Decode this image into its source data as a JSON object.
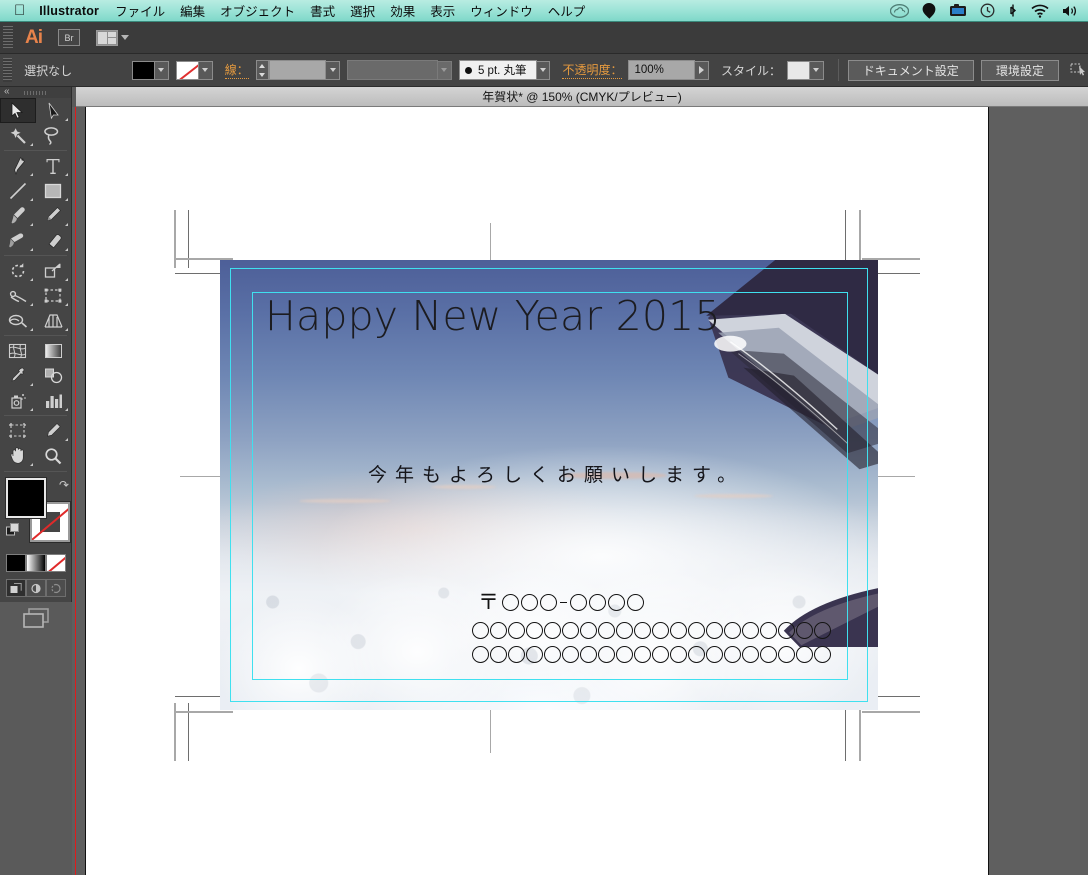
{
  "menubar": {
    "apple_icon": "apple-icon",
    "app_title": "Illustrator",
    "items": [
      "ファイル",
      "編集",
      "オブジェクト",
      "書式",
      "選択",
      "効果",
      "表示",
      "ウィンドウ",
      "ヘルプ"
    ],
    "status_icons": [
      "creative-cloud-icon",
      "dropbox-icon",
      "screen-share-icon",
      "time-machine-icon",
      "bluetooth-icon",
      "wifi-icon",
      "volume-icon"
    ],
    "bg_color": "#9fe4d8"
  },
  "appbar": {
    "logo": "Ai",
    "bridge_label": "Br",
    "arrange_label": "arrange-documents"
  },
  "controlbar": {
    "selection_status": "選択なし",
    "fill_swatch": "#000000",
    "stroke_swatch": "none",
    "stroke_label": "線：",
    "stroke_weight_value": "",
    "stroke_profile_value": "",
    "brush_value": "5 pt. 丸筆",
    "opacity_label": "不透明度：",
    "opacity_value": "100%",
    "style_label": "スタイル：",
    "document_setup_button": "ドキュメント設定",
    "preferences_button": "環境設定",
    "accent_color": "#e59a3f"
  },
  "document_tab": {
    "title": "年賀状* @ 150% (CMYK/プレビュー)",
    "name": "年賀状*",
    "zoom": "150%",
    "color_mode": "CMYK",
    "view_mode": "プレビュー",
    "modified": true
  },
  "tools": {
    "column_left": [
      "selection-tool",
      "magic-wand-tool",
      "pen-tool",
      "line-segment-tool",
      "paintbrush-tool",
      "blob-brush-tool",
      "rotate-tool",
      "scale-tool",
      "width-tool",
      "shape-builder-tool",
      "mesh-tool",
      "eyedropper-tool",
      "symbol-sprayer-tool",
      "artboard-tool",
      "hand-tool"
    ],
    "column_right": [
      "direct-selection-tool",
      "lasso-tool",
      "type-tool",
      "rectangle-tool",
      "pencil-tool",
      "eraser-tool",
      "free-transform-tool",
      "perspective-grid-tool",
      "warp-tool",
      "column-graph-tool",
      "gradient-tool",
      "blend-tool",
      "slice-tool",
      "zoom-tool"
    ],
    "fill_color": "#000000",
    "stroke_color": "none",
    "fill_mode_icons": [
      "color-fill-icon",
      "gradient-fill-icon",
      "none-fill-icon"
    ],
    "draw_mode_icons": [
      "draw-normal-icon",
      "draw-behind-icon",
      "draw-inside-icon"
    ],
    "screen_mode_icon": "screen-mode-icon"
  },
  "canvas": {
    "background_color": "#5f5f5f",
    "page_color": "#ffffff",
    "guide_color": "#3fe0ef",
    "bleed_guide_color": "#e01b1b"
  },
  "artwork": {
    "headline": "Happy New Year 2015",
    "greeting": "今年もよろしくお願いします。",
    "postal_mark": "〒",
    "postal_code_groups": [
      3,
      4
    ],
    "postal_separator": "-",
    "address_rows": [
      20,
      20
    ],
    "image_subject": "airplane-wing-above-clouds-photo",
    "headline_color": "#1c1c20",
    "greeting_color": "#15151a"
  }
}
